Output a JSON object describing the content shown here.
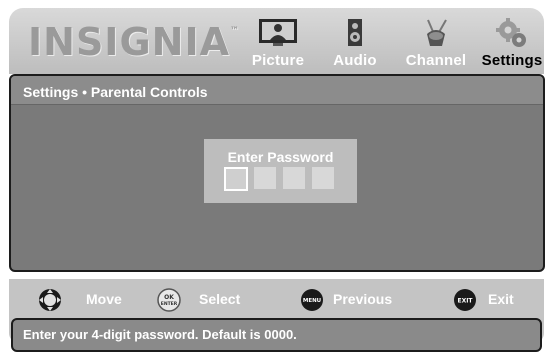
{
  "brand": {
    "name": "INSIGNIA",
    "mark": "™"
  },
  "tabs": [
    {
      "label": "Picture",
      "icon": "picture-icon"
    },
    {
      "label": "Audio",
      "icon": "speaker-icon"
    },
    {
      "label": "Channel",
      "icon": "antenna-icon"
    },
    {
      "label": "Settings",
      "icon": "gears-icon",
      "active": true
    }
  ],
  "panel": {
    "breadcrumb": "Settings • Parental Controls",
    "password": {
      "title": "Enter Password",
      "digits": 4,
      "active_index": 0
    }
  },
  "controls": [
    {
      "button": "dpad",
      "label": "Move"
    },
    {
      "button": "OK ENTER",
      "label": "Select"
    },
    {
      "button": "MENU",
      "label": "Previous"
    },
    {
      "button": "EXIT",
      "label": "Exit"
    }
  ],
  "status": "Enter your 4-digit password. Default is 0000.",
  "colors": {
    "active_tab_label": "#000000",
    "inactive_tab_label": "#ffffff",
    "panel_bg": "#7a7a7a",
    "password_box": "#bdbdbd"
  }
}
